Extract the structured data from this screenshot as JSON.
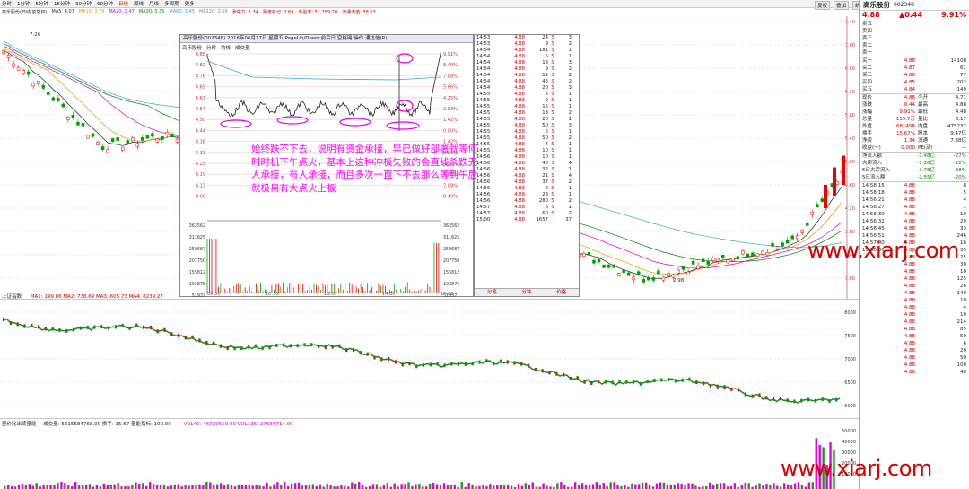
{
  "toolbar": {
    "items": [
      "分时",
      "1分钟",
      "5分钟",
      "15分钟",
      "30分钟",
      "60分钟",
      "日线",
      "周线",
      "月线",
      "多周期",
      "更多"
    ],
    "right": [
      "复权",
      "叠加",
      "统计",
      "画线",
      "F10",
      "标记",
      "+自选",
      "返回"
    ]
  },
  "ma_bar": {
    "title": "高乐股份(日线,前复权)",
    "ma5": "MA5: 4.07",
    "ma10": "MA10: 3.79",
    "ma20": "MA20: 3.47",
    "ma30": "MA30: 3.35",
    "ma60": "MA60: 3.45",
    "ma120": "MA120: 3.69",
    "indicator": "涨停力: 1.34",
    "indicator2": "距离标记: 0.69",
    "indicator3": "市盈率: 51,359.20",
    "indicator4": "流通市值: 38.03",
    "price_high_label": "7.26",
    "price_low_label": "2.98"
  },
  "main_yaxis": [
    "7.40",
    "7.00",
    "6.60",
    "6.20",
    "5.80",
    "5.40",
    "5.00",
    "4.60",
    "4.20",
    "3.80",
    "3.40",
    "3.00"
  ],
  "popup": {
    "title": "高乐股份(002348) 2016年06月17日 星期五 PageUp/Down:前后日 空格键:操作 通达信(R)",
    "tabs": [
      "高乐股份",
      "分时",
      "均线",
      "成交量"
    ],
    "yleft": [
      "4.88",
      "4.82",
      "4.76",
      "4.69",
      "4.63",
      "4.57",
      "4.50",
      "4.44",
      "4.38",
      "4.31",
      "4.25",
      "4.19",
      "4.13",
      "4.06"
    ],
    "yright": [
      "9.91%",
      "8.49%",
      "7.08%",
      "5.66%",
      "4.25%",
      "2.83%",
      "1.42%",
      "0.00%",
      "1.42%",
      "2.83%",
      "4.25%",
      "5.66%",
      "7.08%",
      "8.49%"
    ],
    "vol_y": [
      "363562",
      "311625",
      "259687",
      "207750",
      "155812",
      "103875",
      "51937"
    ],
    "times": [
      "09:30",
      "10:30",
      "13:00",
      "14:00",
      "15:00"
    ]
  },
  "ticks": [
    [
      "14:53",
      "4.88",
      "24",
      "S",
      "3"
    ],
    [
      "14:53",
      "4.88",
      "9",
      "S",
      "2"
    ],
    [
      "14:54",
      "4.88",
      "181",
      "S",
      "1"
    ],
    [
      "14:54",
      "4.88",
      "5",
      "S",
      "1"
    ],
    [
      "14:54",
      "4.88",
      "13",
      "S",
      "3"
    ],
    [
      "14:54",
      "4.88",
      "9",
      "S",
      "2"
    ],
    [
      "14:54",
      "4.88",
      "12",
      "S",
      "2"
    ],
    [
      "14:54",
      "4.88",
      "45",
      "S",
      "2"
    ],
    [
      "14:54",
      "4.88",
      "20",
      "S",
      "3"
    ],
    [
      "14:55",
      "4.88",
      "5",
      "S",
      "1"
    ],
    [
      "14:55",
      "4.88",
      "9",
      "S",
      "1"
    ],
    [
      "14:55",
      "4.88",
      "15",
      "S",
      "1"
    ],
    [
      "14:55",
      "4.88",
      "13",
      "S",
      "2"
    ],
    [
      "14:55",
      "4.88",
      "20",
      "S",
      "1"
    ],
    [
      "14:55",
      "4.88",
      "50",
      "S",
      "3"
    ],
    [
      "14:55",
      "4.88",
      "5",
      "S",
      "1"
    ],
    [
      "14:55",
      "4.88",
      "50",
      "S",
      "2"
    ],
    [
      "14:55",
      "4.88",
      "4",
      "S",
      "1"
    ],
    [
      "14:55",
      "4.88",
      "10",
      "S",
      "1"
    ],
    [
      "14:56",
      "4.88",
      "10",
      "S",
      "1"
    ],
    [
      "14:56",
      "4.88",
      "40",
      "S",
      "4"
    ],
    [
      "14:56",
      "4.88",
      "32",
      "S",
      "1"
    ],
    [
      "14:56",
      "4.88",
      "21",
      "S",
      "4"
    ],
    [
      "14:56",
      "4.88",
      "37",
      "S",
      "2"
    ],
    [
      "14:56",
      "4.88",
      "2",
      "S",
      "1"
    ],
    [
      "14:56",
      "4.88",
      "23",
      "S",
      "1"
    ],
    [
      "14:56",
      "4.88",
      "280",
      "S",
      "2"
    ],
    [
      "14:57",
      "4.88",
      "6",
      "S",
      "1"
    ],
    [
      "14:57",
      "4.88",
      "60",
      "S",
      "2"
    ],
    [
      "15:00",
      "4.88",
      "1657",
      "",
      "37"
    ]
  ],
  "tick_tabs": [
    "分笔",
    "分钟",
    "价格"
  ],
  "annotation": "始终跌不下去，说明有资金承接，早已做好部署就等何时时机下午点火，基本上这种冲板失败的会直线杀跌无人承接，有人承接，而且多次一直下不去那么等到午后就极易有大点火上板",
  "quote": {
    "name": "高乐股份",
    "code": "002348",
    "price": "4.88",
    "change": "▲0.44",
    "pct": "9.91%",
    "ask": [
      [
        "卖五",
        "",
        ""
      ],
      [
        "卖四",
        "",
        ""
      ],
      [
        "卖三",
        "",
        ""
      ],
      [
        "卖二",
        "",
        ""
      ],
      [
        "卖一",
        "",
        ""
      ]
    ],
    "bid": [
      [
        "买一",
        "4.88",
        "14108"
      ],
      [
        "买二",
        "4.87",
        "61"
      ],
      [
        "买三",
        "4.86",
        "77"
      ],
      [
        "买四",
        "4.85",
        "202"
      ],
      [
        "买五",
        "4.84",
        "149"
      ]
    ],
    "stats": [
      [
        "现价",
        "4.88",
        "今开",
        "4.71"
      ],
      [
        "涨跌",
        "0.44",
        "最高",
        "4.88"
      ],
      [
        "涨幅",
        "9.91%",
        "最低",
        "4.48"
      ],
      [
        "总量",
        "115.7万",
        "量比",
        "3.17"
      ],
      [
        "外盘",
        "681456",
        "内盘",
        "475232"
      ],
      [
        "换手",
        "15.67%",
        "股本",
        "9.47亿"
      ],
      [
        "净资",
        "1.34",
        "流通",
        "7.38亿"
      ],
      [
        "收益(一)",
        "0.000",
        "PE(动)",
        "—"
      ]
    ],
    "flows": [
      [
        "净流入额",
        "-1.48亿",
        "-27%"
      ],
      [
        "大宗流入",
        "-1.28亿",
        "-22%"
      ],
      [
        "5日大宗流入",
        "-3.78亿",
        "-38%"
      ],
      [
        "5日流入额",
        "-2.55亿",
        "-20%"
      ]
    ],
    "ticks": [
      [
        "14:58:15",
        "4.88",
        "8"
      ],
      [
        "14:58:18",
        "4.88",
        "5"
      ],
      [
        "14:56:21",
        "4.88",
        "4"
      ],
      [
        "14:56:27",
        "4.88",
        "1"
      ],
      [
        "14:56:30",
        "4.88",
        "10"
      ],
      [
        "14:56:32",
        "4.88",
        "29"
      ],
      [
        "14:58:45",
        "4.88",
        "33"
      ],
      [
        "14:56:51",
        "4.88",
        "246"
      ],
      [
        "14:57:00",
        "4.88",
        "16"
      ],
      [
        "15:00:00",
        "4.88",
        "35"
      ],
      [
        "",
        "4.88",
        "25"
      ],
      [
        "",
        "4.88",
        "30"
      ],
      [
        "",
        "4.88",
        "10"
      ],
      [
        "",
        "4.88",
        "125"
      ],
      [
        "",
        "4.88",
        "26"
      ],
      [
        "",
        "4.88",
        "140"
      ],
      [
        "",
        "4.88",
        "10"
      ],
      [
        "",
        "4.88",
        "4"
      ],
      [
        "",
        "4.88",
        "10"
      ],
      [
        "",
        "4.88",
        "214"
      ],
      [
        "",
        "4.88",
        "85"
      ],
      [
        "",
        "4.88",
        "50"
      ],
      [
        "",
        "4.88",
        "6"
      ],
      [
        "",
        "4.88",
        "20"
      ],
      [
        "",
        "4.88",
        "50"
      ],
      [
        "",
        "4.88",
        "100"
      ],
      [
        "",
        "4.88",
        "40"
      ]
    ]
  },
  "panel2": {
    "label": "上证指数",
    "ma": "MA1: 199.86  MA2: 738.69  MA3: 605.73  MA4: 8239.27",
    "yaxis": [
      "8000",
      "7500",
      "7000",
      "6500",
      "6000"
    ]
  },
  "panel3": {
    "label": "量价比出货量能",
    "vol": "成交量: 5615584768.00  换手: 15.67  量能指标: 100.00",
    "vol2": "VOL40: 46729559.00  VOL135: 27636714.00",
    "yaxis": [
      "50000",
      "40000",
      "30000",
      "20000",
      "10000"
    ]
  },
  "watermark": "www.xiarj.com",
  "colors": {
    "up": "#e00000",
    "down": "#00a000",
    "annotation": "#ff00ff",
    "ma_blue": "#3aa0e0"
  }
}
